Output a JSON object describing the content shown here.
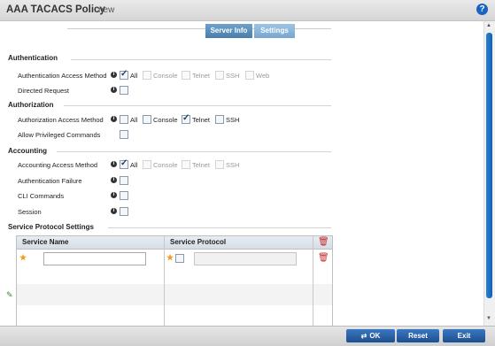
{
  "window": {
    "title": "AAA TACACS Policy",
    "subtitle": "new",
    "help_icon": "?"
  },
  "tabs": [
    {
      "label": "Server Info",
      "active": false
    },
    {
      "label": "Settings",
      "active": true
    }
  ],
  "authentication": {
    "section_label": "Authentication",
    "access_method_label": "Authentication Access Method",
    "access_methods": [
      {
        "label": "All",
        "checked": true,
        "enabled": true
      },
      {
        "label": "Console",
        "checked": false,
        "enabled": false
      },
      {
        "label": "Telnet",
        "checked": false,
        "enabled": false
      },
      {
        "label": "SSH",
        "checked": false,
        "enabled": false
      },
      {
        "label": "Web",
        "checked": false,
        "enabled": false
      }
    ],
    "directed_request_label": "Directed Request",
    "directed_request_checked": false
  },
  "authorization": {
    "section_label": "Authorization",
    "access_method_label": "Authorization Access Method",
    "access_methods": [
      {
        "label": "All",
        "checked": false,
        "enabled": true
      },
      {
        "label": "Console",
        "checked": false,
        "enabled": true
      },
      {
        "label": "Telnet",
        "checked": true,
        "enabled": true
      },
      {
        "label": "SSH",
        "checked": false,
        "enabled": true
      }
    ],
    "privileged_label": "Allow Privileged Commands",
    "privileged_checked": false
  },
  "accounting": {
    "section_label": "Accounting",
    "access_method_label": "Accounting Access Method",
    "access_methods": [
      {
        "label": "All",
        "checked": true,
        "enabled": true
      },
      {
        "label": "Console",
        "checked": false,
        "enabled": false
      },
      {
        "label": "Telnet",
        "checked": false,
        "enabled": false
      },
      {
        "label": "SSH",
        "checked": false,
        "enabled": false
      }
    ],
    "auth_failure_label": "Authentication Failure",
    "cli_commands_label": "CLI Commands",
    "session_label": "Session"
  },
  "service_protocol": {
    "section_label": "Service Protocol Settings",
    "columns": [
      "Service Name",
      "Service Protocol"
    ],
    "rows": [
      {
        "service_name": "",
        "service_protocol_value": "",
        "protocol_checked": false
      }
    ]
  },
  "footer": {
    "ok_label": "OK",
    "reset_label": "Reset",
    "exit_label": "Exit"
  },
  "colors": {
    "tab_active": "#78a6cf",
    "tab_inactive": "#4a7eaa",
    "button": "#2a63a8",
    "star": "#f39a1e",
    "trash": "#c62828"
  }
}
